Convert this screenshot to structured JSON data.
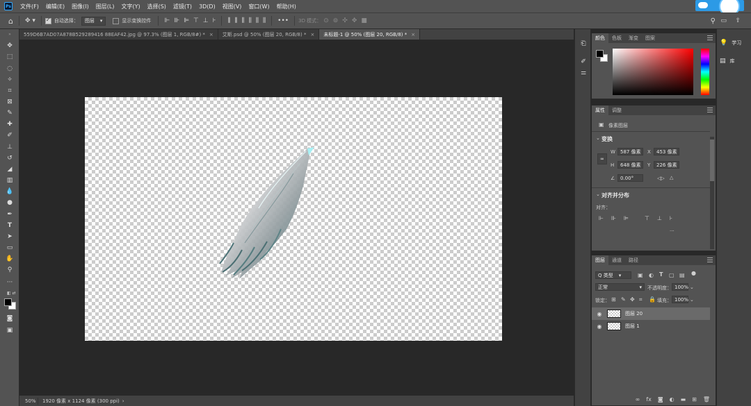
{
  "app": {
    "logo": "Ps"
  },
  "menu": [
    "文件(F)",
    "编辑(E)",
    "图像(I)",
    "图层(L)",
    "文字(Y)",
    "选择(S)",
    "滤镜(T)",
    "3D(D)",
    "视图(V)",
    "窗口(W)",
    "帮助(H)"
  ],
  "options": {
    "auto_select_label": "自动选择：",
    "auto_select_value": "图层",
    "show_transform_label": "显示变换控件",
    "mode_3d_label": "3D 模式："
  },
  "tabs": [
    {
      "label": "559D6B7AD07A878B529289416 88EAF42.jpg @ 97.3% (图层 1, RGB/8#) *",
      "active": false
    },
    {
      "label": "艾斯.psd @ 50% (图层 20, RGB/8) *",
      "active": false
    },
    {
      "label": "未标题-1 @ 50% (图层 20, RGB/8) *",
      "active": true
    }
  ],
  "status": {
    "zoom": "50%",
    "doc_info": "1920 像素 x 1124 像素 (300 ppi)"
  },
  "color_panel": {
    "tabs": [
      "颜色",
      "色板",
      "渐变",
      "图案"
    ],
    "fg_color": "#000000",
    "bg_color": "#ffffff",
    "hue": "#ff0000"
  },
  "properties_panel": {
    "tabs": [
      "属性",
      "调整"
    ],
    "layer_type": "像素图层",
    "transform_title": "变换",
    "w_label": "W",
    "w_value": "587 像素",
    "h_label": "H",
    "h_value": "648 像素",
    "x_label": "X",
    "x_value": "453 像素",
    "y_label": "Y",
    "y_value": "226 像素",
    "angle_value": "0.00°",
    "align_title": "对齐并分布",
    "align_label": "对齐：",
    "more": "···"
  },
  "layers_panel": {
    "tabs": [
      "图层",
      "通道",
      "路径"
    ],
    "filter_type": "Q 类型",
    "blend_mode": "正常",
    "opacity_label": "不透明度：",
    "opacity_value": "100%",
    "lock_label": "锁定：",
    "fill_label": "填充：",
    "fill_value": "100%",
    "layers": [
      {
        "name": "图层 20",
        "selected": true
      },
      {
        "name": "图层 1",
        "selected": false
      }
    ]
  },
  "right_dock": {
    "learn": "学习",
    "library": "库"
  }
}
